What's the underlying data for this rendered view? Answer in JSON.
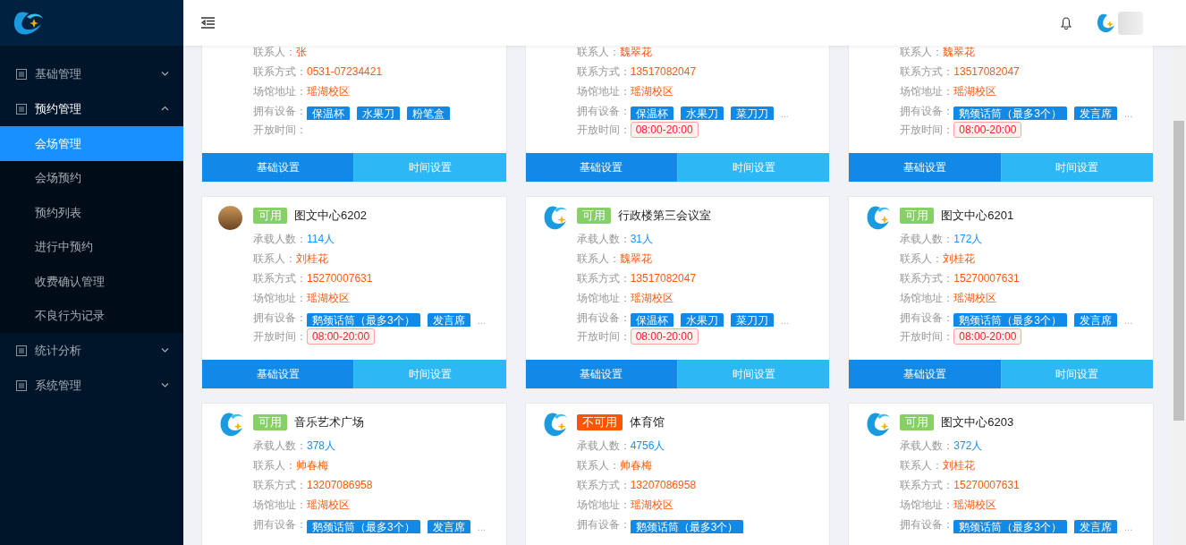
{
  "sidebar": {
    "items": [
      {
        "label": "基础管理",
        "expanded": false
      },
      {
        "label": "预约管理",
        "expanded": true,
        "children": [
          {
            "label": "会场管理",
            "selected": true
          },
          {
            "label": "会场预约",
            "selected": false
          },
          {
            "label": "预约列表",
            "selected": false
          },
          {
            "label": "进行中预约",
            "selected": false
          },
          {
            "label": "收费确认管理",
            "selected": false
          },
          {
            "label": "不良行为记录",
            "selected": false
          }
        ]
      },
      {
        "label": "统计分析",
        "expanded": false
      },
      {
        "label": "系统管理",
        "expanded": false
      }
    ]
  },
  "cards": [
    {
      "rows": [
        {
          "kind": "text",
          "label": "联系人：",
          "value": "张"
        },
        {
          "kind": "text",
          "label": "联系方式：",
          "value": "0531-07234421"
        },
        {
          "kind": "text",
          "label": "场馆地址：",
          "value": "瑶湖校区"
        },
        {
          "kind": "tags",
          "label": "拥有设备：",
          "tags": [
            "保温杯",
            "水果刀",
            "粉笔盒"
          ]
        },
        {
          "kind": "time",
          "label": "开放时间："
        }
      ],
      "buttons": [
        "基础设置",
        "时间设置"
      ]
    },
    {
      "rows": [
        {
          "kind": "text",
          "label": "联系人：",
          "value": "魏翠花"
        },
        {
          "kind": "text",
          "label": "联系方式：",
          "value": "13517082047"
        },
        {
          "kind": "text",
          "label": "场馆地址：",
          "value": "瑶湖校区"
        },
        {
          "kind": "tags",
          "label": "拥有设备：",
          "tags": [
            "保温杯",
            "水果刀",
            "菜刀刀"
          ],
          "more": "..."
        },
        {
          "kind": "time",
          "label": "开放时间：",
          "value": "08:00-20:00"
        }
      ],
      "buttons": [
        "基础设置",
        "时间设置"
      ]
    },
    {
      "rows": [
        {
          "kind": "text",
          "label": "联系人：",
          "value": "魏翠花"
        },
        {
          "kind": "text",
          "label": "联系方式：",
          "value": "13517082047"
        },
        {
          "kind": "text",
          "label": "场馆地址：",
          "value": "瑶湖校区"
        },
        {
          "kind": "tags",
          "label": "拥有设备：",
          "tags": [
            "鹅颈话筒（最多3个）",
            "发言席"
          ],
          "more": "..."
        },
        {
          "kind": "time",
          "label": "开放时间：",
          "value": "08:00-20:00"
        }
      ],
      "buttons": [
        "基础设置",
        "时间设置"
      ]
    },
    {
      "kind": "photo",
      "status": "可用",
      "available": true,
      "title": "图文中心6202",
      "rows": [
        {
          "kind": "count",
          "label": "承载人数：",
          "value": "114人"
        },
        {
          "kind": "text",
          "label": "联系人：",
          "value": "刘桂花"
        },
        {
          "kind": "text",
          "label": "联系方式：",
          "value": "15270007631"
        },
        {
          "kind": "text",
          "label": "场馆地址：",
          "value": "瑶湖校区"
        },
        {
          "kind": "tags",
          "label": "拥有设备：",
          "tags": [
            "鹅颈话筒（最多3个）",
            "发言席"
          ],
          "more": "..."
        },
        {
          "kind": "time",
          "label": "开放时间：",
          "value": "08:00-20:00"
        }
      ],
      "buttons": [
        "基础设置",
        "时间设置"
      ]
    },
    {
      "kind": "logo",
      "status": "可用",
      "available": true,
      "title": "行政楼第三会议室",
      "rows": [
        {
          "kind": "count",
          "label": "承载人数：",
          "value": "31人"
        },
        {
          "kind": "text",
          "label": "联系人：",
          "value": "魏翠花"
        },
        {
          "kind": "text",
          "label": "联系方式：",
          "value": "13517082047"
        },
        {
          "kind": "text",
          "label": "场馆地址：",
          "value": "瑶湖校区"
        },
        {
          "kind": "tags",
          "label": "拥有设备：",
          "tags": [
            "保温杯",
            "水果刀",
            "菜刀刀"
          ],
          "more": "..."
        },
        {
          "kind": "time",
          "label": "开放时间：",
          "value": "08:00-20:00"
        }
      ],
      "buttons": [
        "基础设置",
        "时间设置"
      ]
    },
    {
      "kind": "logo",
      "status": "可用",
      "available": true,
      "title": "图文中心6201",
      "rows": [
        {
          "kind": "count",
          "label": "承载人数：",
          "value": "172人"
        },
        {
          "kind": "text",
          "label": "联系人：",
          "value": "刘桂花"
        },
        {
          "kind": "text",
          "label": "联系方式：",
          "value": "15270007631"
        },
        {
          "kind": "text",
          "label": "场馆地址：",
          "value": "瑶湖校区"
        },
        {
          "kind": "tags",
          "label": "拥有设备：",
          "tags": [
            "鹅颈话筒（最多3个）",
            "发言席"
          ],
          "more": "..."
        },
        {
          "kind": "time",
          "label": "开放时间：",
          "value": "08:00-20:00"
        }
      ],
      "buttons": [
        "基础设置",
        "时间设置"
      ]
    },
    {
      "kind": "logo",
      "status": "可用",
      "available": true,
      "title": "音乐艺术广场",
      "rows": [
        {
          "kind": "count",
          "label": "承载人数：",
          "value": "378人"
        },
        {
          "kind": "text",
          "label": "联系人：",
          "value": "帅春梅"
        },
        {
          "kind": "text",
          "label": "联系方式：",
          "value": "13207086958"
        },
        {
          "kind": "text",
          "label": "场馆地址：",
          "value": "瑶湖校区"
        },
        {
          "kind": "tags",
          "label": "拥有设备：",
          "tags": [
            "鹅颈话筒（最多3个）",
            "发言席"
          ],
          "more": "..."
        }
      ]
    },
    {
      "kind": "logo",
      "status": "不可用",
      "available": false,
      "title": "体育馆",
      "rows": [
        {
          "kind": "count",
          "label": "承载人数：",
          "value": "4756人"
        },
        {
          "kind": "text",
          "label": "联系人：",
          "value": "帅春梅"
        },
        {
          "kind": "text",
          "label": "联系方式：",
          "value": "13207086958"
        },
        {
          "kind": "text",
          "label": "场馆地址：",
          "value": "瑶湖校区"
        },
        {
          "kind": "tags",
          "label": "拥有设备：",
          "tags": [
            "鹅颈话筒（最多3个）"
          ]
        }
      ]
    },
    {
      "kind": "logo",
      "status": "可用",
      "available": true,
      "title": "图文中心6203",
      "rows": [
        {
          "kind": "count",
          "label": "承载人数：",
          "value": "372人"
        },
        {
          "kind": "text",
          "label": "联系人：",
          "value": "刘桂花"
        },
        {
          "kind": "text",
          "label": "联系方式：",
          "value": "15270007631"
        },
        {
          "kind": "text",
          "label": "场馆地址：",
          "value": "瑶湖校区"
        },
        {
          "kind": "tags",
          "label": "拥有设备：",
          "tags": [
            "鹅颈话筒（最多3个）",
            "发言席"
          ],
          "more": "..."
        }
      ]
    }
  ]
}
